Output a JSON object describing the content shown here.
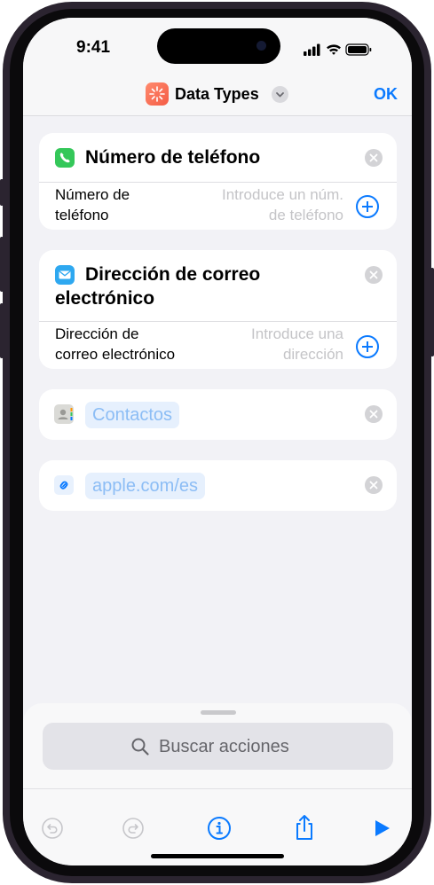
{
  "status": {
    "time": "9:41"
  },
  "nav": {
    "title": "Data Types",
    "done_label": "OK"
  },
  "cards": {
    "phone": {
      "title": "Número de teléfono",
      "label_line1": "Número de",
      "label_line2": "teléfono",
      "placeholder_line1": "Introduce un núm.",
      "placeholder_line2": "de teléfono"
    },
    "email": {
      "title_line1": "Dirección de correo",
      "title_line2": "electrónico",
      "label_line1": "Dirección de",
      "label_line2": "correo electrónico",
      "placeholder_line1": "Introduce una",
      "placeholder_line2": "dirección"
    },
    "contacts": {
      "value": "Contactos"
    },
    "url": {
      "value": "apple.com/es"
    }
  },
  "search": {
    "placeholder": "Buscar acciones"
  },
  "colors": {
    "accent": "#0a7aff",
    "phone_icon": "#34c759",
    "mail_icon": "#2ea8f0"
  }
}
